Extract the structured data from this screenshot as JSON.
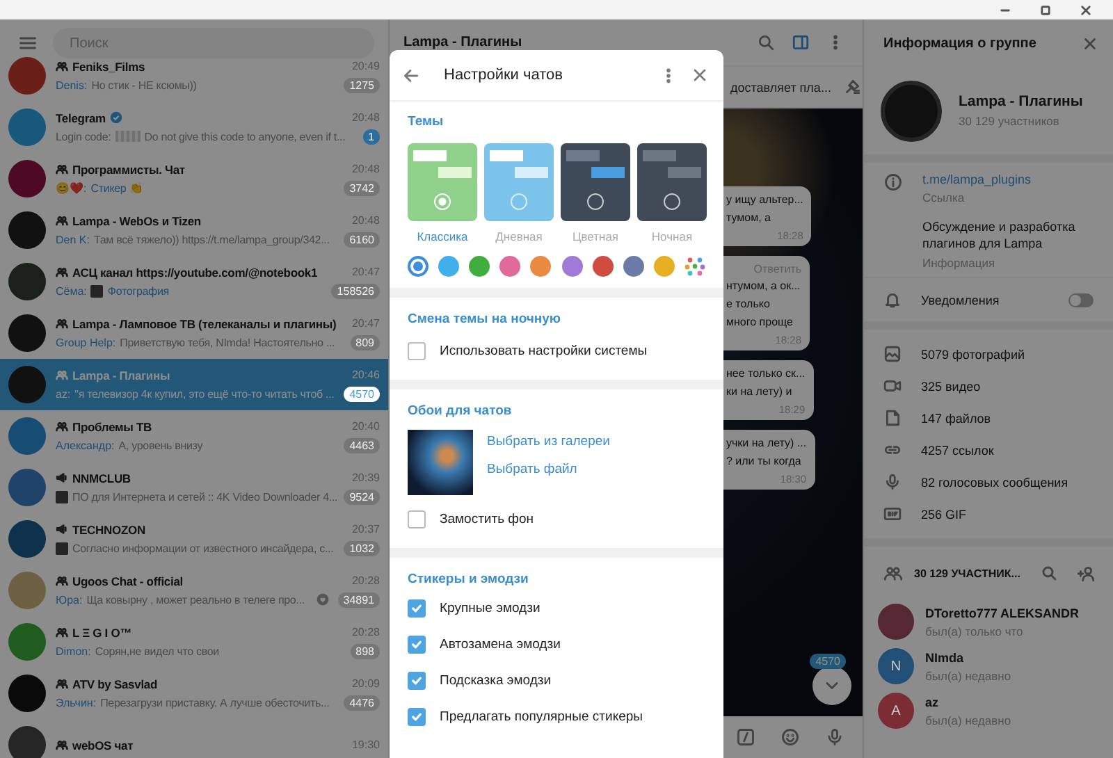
{
  "search": {
    "placeholder": "Поиск"
  },
  "chats": [
    {
      "name": "Feniks_Films",
      "kind": "group",
      "verified": false,
      "time": "20:49",
      "sender": "Denis:",
      "preview": "Но стик - НЕ ксюмы))",
      "media": false,
      "thumb": false,
      "reaction": false,
      "unread": "1275",
      "muted": true,
      "selected": false,
      "color": "#6a2018"
    },
    {
      "name": "Telegram",
      "kind": "user",
      "verified": true,
      "time": "20:48",
      "prefix": "Login code:",
      "preview": "Do not give this code to anyone, even if t...",
      "media": false,
      "thumb": false,
      "reaction": false,
      "unread": "1",
      "muted": false,
      "selected": false,
      "color": "#18587a"
    },
    {
      "name": "Программисты. Чат",
      "kind": "group",
      "verified": false,
      "time": "20:48",
      "sender": "😊❤️:",
      "preview": "Стикер 👏",
      "media": true,
      "thumb": false,
      "reaction": false,
      "unread": "3742",
      "muted": true,
      "selected": false,
      "color": "#4c0a24"
    },
    {
      "name": "Lampa - WebOs и Tizen",
      "kind": "group",
      "verified": false,
      "time": "20:48",
      "sender": "Den K:",
      "preview": "Там всё тяжело)) https://t.me/lampa_group/342...",
      "media": false,
      "thumb": false,
      "reaction": false,
      "unread": "6160",
      "muted": true,
      "selected": false,
      "color": "#111111"
    },
    {
      "name": "АСЦ канал https://youtube.com/@notebook1",
      "kind": "group",
      "verified": false,
      "time": "20:47",
      "sender": "Сёма:",
      "preview": "Фотография",
      "media": true,
      "thumb": true,
      "reaction": false,
      "unread": "158526",
      "muted": true,
      "selected": false,
      "color": "#1a201a"
    },
    {
      "name": "Lampa - Ламповое ТВ (телеканалы и плагины)",
      "kind": "group",
      "verified": false,
      "time": "20:47",
      "sender": "Group Help:",
      "preview": "Приветствую тебя,  NImda! Настоятельно ...",
      "media": false,
      "thumb": false,
      "reaction": false,
      "unread": "809",
      "muted": true,
      "selected": false,
      "color": "#111111"
    },
    {
      "name": "Lampa - Плагины",
      "kind": "group",
      "verified": false,
      "time": "20:46",
      "sender": "az:",
      "preview": "\"я телевизор 4к купил, это ещё что-то читать чтоб ...",
      "media": false,
      "thumb": false,
      "reaction": false,
      "unread": "4570",
      "muted": true,
      "selected": true,
      "color": "#111111"
    },
    {
      "name": "Проблемы ТВ",
      "kind": "group",
      "verified": false,
      "time": "20:40",
      "sender": "Александр:",
      "preview": "А, уровень внизу",
      "media": false,
      "thumb": false,
      "reaction": false,
      "unread": "4463",
      "muted": true,
      "selected": false,
      "color": "#174d72"
    },
    {
      "name": "NNMCLUB",
      "kind": "channel",
      "verified": false,
      "time": "20:39",
      "preview": "ПО для Интернета и сетей :: 4K Video Downloader 4...",
      "media": false,
      "thumb": true,
      "reaction": false,
      "unread": "9524",
      "muted": true,
      "selected": false,
      "color": "#204369"
    },
    {
      "name": "TECHNOZON",
      "kind": "channel",
      "verified": false,
      "time": "20:37",
      "preview": "Согласно информации от известного инсайдера, с...",
      "media": false,
      "thumb": true,
      "reaction": false,
      "unread": "1032",
      "muted": true,
      "selected": false,
      "color": "#0e314c"
    },
    {
      "name": "Ugoos Chat - official",
      "kind": "group",
      "verified": false,
      "time": "20:28",
      "sender": "Юра:",
      "preview": "Ща ковырну , может реально в телеге про...",
      "media": false,
      "thumb": false,
      "reaction": true,
      "unread": "34891",
      "muted": true,
      "selected": false,
      "color": "#6e6143"
    },
    {
      "name": "L Ξ G I O™",
      "kind": "group",
      "verified": false,
      "time": "20:28",
      "sender": "Dimon:",
      "preview": "Сорян,не видел что свои",
      "media": false,
      "thumb": false,
      "reaction": false,
      "unread": "898",
      "muted": true,
      "selected": false,
      "color": "#205c20"
    },
    {
      "name": "ATV by Sasvlad",
      "kind": "group",
      "verified": false,
      "time": "20:09",
      "sender": "Эльчин:",
      "preview": "Перезагрузи приставку. А лучше обесточить...",
      "media": false,
      "thumb": false,
      "reaction": false,
      "unread": "4476",
      "muted": true,
      "selected": false,
      "color": "#0a0a0a"
    },
    {
      "name": "webOS чат",
      "kind": "group",
      "verified": false,
      "time": "19:30",
      "selected": false,
      "color": "#262626"
    }
  ],
  "chat": {
    "title": "Lampa - Плагины",
    "pinned": "доставляет пла...",
    "messages": [
      {
        "lines": [
          "у ищу альтер...",
          "тумом, а"
        ],
        "time": "18:28"
      },
      {
        "reply": "Ответить",
        "lines": [
          "нтумом, а ок...",
          "е только",
          "много проще"
        ],
        "time": "18:28"
      },
      {
        "lines": [
          "нее только ск...",
          "ки на лету) и"
        ],
        "time": "18:29"
      },
      {
        "lines": [
          "учки на лету) ...",
          "? или ты когда"
        ],
        "time": "18:30"
      }
    ],
    "unread": "4570"
  },
  "info": {
    "title": "Информация о группе",
    "name": "Lampa - Плагины",
    "members": "30 129 участников",
    "link": "t.me/lampa_plugins",
    "link_label": "Ссылка",
    "description": "Обсуждение и разработка плагинов для Lampa",
    "description_label": "Информация",
    "notifications": {
      "label": "Уведомления",
      "on": false
    },
    "media": [
      {
        "kind": "photo",
        "label": "5079 фотографий"
      },
      {
        "kind": "video",
        "label": "325 видео"
      },
      {
        "kind": "file",
        "label": "147 файлов"
      },
      {
        "kind": "link",
        "label": "4257 ссылок"
      },
      {
        "kind": "voice",
        "label": "82 голосовых сообщения"
      },
      {
        "kind": "gif",
        "label": "256 GIF"
      }
    ],
    "members_header": "30 129 УЧАСТНИК...",
    "member_list": [
      {
        "name": "DToretto777 ALEKSANDR",
        "status": "был(а) только что",
        "kind": "photo",
        "color": "#552832"
      },
      {
        "name": "NImda",
        "status": "был(а) недавно",
        "kind": "letter",
        "initial": "N",
        "color": "#224f76"
      },
      {
        "name": "az",
        "status": "был(а) недавно",
        "kind": "letter",
        "initial": "A",
        "color": "#7b2c34"
      }
    ]
  },
  "settings": {
    "title": "Настройки чатов",
    "themes": {
      "title": "Темы",
      "items": [
        {
          "label": "Классика",
          "kind": "classic",
          "color": "#8fd08a",
          "selected": true
        },
        {
          "label": "Дневная",
          "kind": "day",
          "color": "#7cc3ec",
          "selected": false
        },
        {
          "label": "Цветная",
          "kind": "tinted",
          "color": "#3e4a58",
          "selected": false
        },
        {
          "label": "Ночная",
          "kind": "night",
          "color": "#414b57",
          "selected": false
        }
      ]
    },
    "accents": [
      {
        "kind": "swatch",
        "color": "#3c8fd8",
        "selected": true
      },
      {
        "kind": "swatch",
        "color": "#40b0ea",
        "selected": false
      },
      {
        "kind": "swatch",
        "color": "#3fae3f",
        "selected": false
      },
      {
        "kind": "swatch",
        "color": "#e06a9a",
        "selected": false
      },
      {
        "kind": "swatch",
        "color": "#e88a40",
        "selected": false
      },
      {
        "kind": "swatch",
        "color": "#a07ad6",
        "selected": false
      },
      {
        "kind": "swatch",
        "color": "#d04b40",
        "selected": false
      },
      {
        "kind": "swatch",
        "color": "#6b7aa8",
        "selected": false
      },
      {
        "kind": "swatch",
        "color": "#e6b020",
        "selected": false
      },
      {
        "kind": "palette",
        "selected": false
      }
    ],
    "night_switch": {
      "title": "Смена темы на ночную",
      "option": {
        "label": "Использовать настройки системы",
        "checked": false
      }
    },
    "wallpaper": {
      "title": "Обои для чатов",
      "links": [
        "Выбрать из галереи",
        "Выбрать файл"
      ],
      "tile": {
        "label": "Замостить фон",
        "checked": false
      }
    },
    "stickers": {
      "title": "Стикеры и эмодзи",
      "options": [
        {
          "label": "Крупные эмодзи",
          "checked": true
        },
        {
          "label": "Автозамена эмодзи",
          "checked": true
        },
        {
          "label": "Подсказка эмодзи",
          "checked": true
        },
        {
          "label": "Предлагать популярные стикеры",
          "checked": true
        }
      ]
    }
  }
}
